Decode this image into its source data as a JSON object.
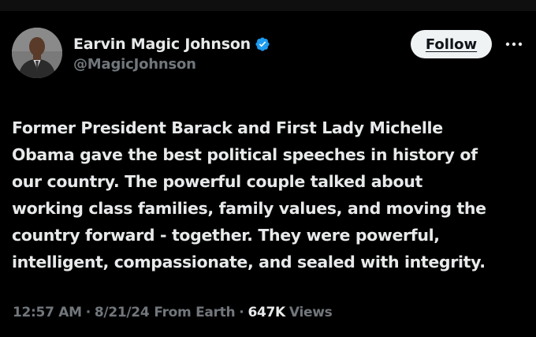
{
  "author": {
    "display_name": "Earvin Magic Johnson",
    "handle": "@MagicJohnson",
    "verified": true,
    "avatar_icon": "profile-photo"
  },
  "actions": {
    "follow_label": "Follow",
    "more_icon": "more-dots-icon"
  },
  "tweet": {
    "text": "Former President Barack and First Lady Michelle\nObama gave the best political speeches in history of\nour country. The powerful couple talked about\nworking class families, family values, and moving the\ncountry forward - together. They were powerful,\nintelligent, compassionate, and sealed with integrity."
  },
  "meta": {
    "time": "12:57 AM",
    "separator": "·",
    "date": "8/21/24",
    "source": "From Earth",
    "views_count": "647K",
    "views_label": "Views"
  },
  "colors": {
    "background": "#000000",
    "primary_text": "#e7e9ea",
    "secondary_text": "#71767b",
    "verified_badge": "#1d9bf0",
    "follow_button_bg": "#eff3f4"
  }
}
